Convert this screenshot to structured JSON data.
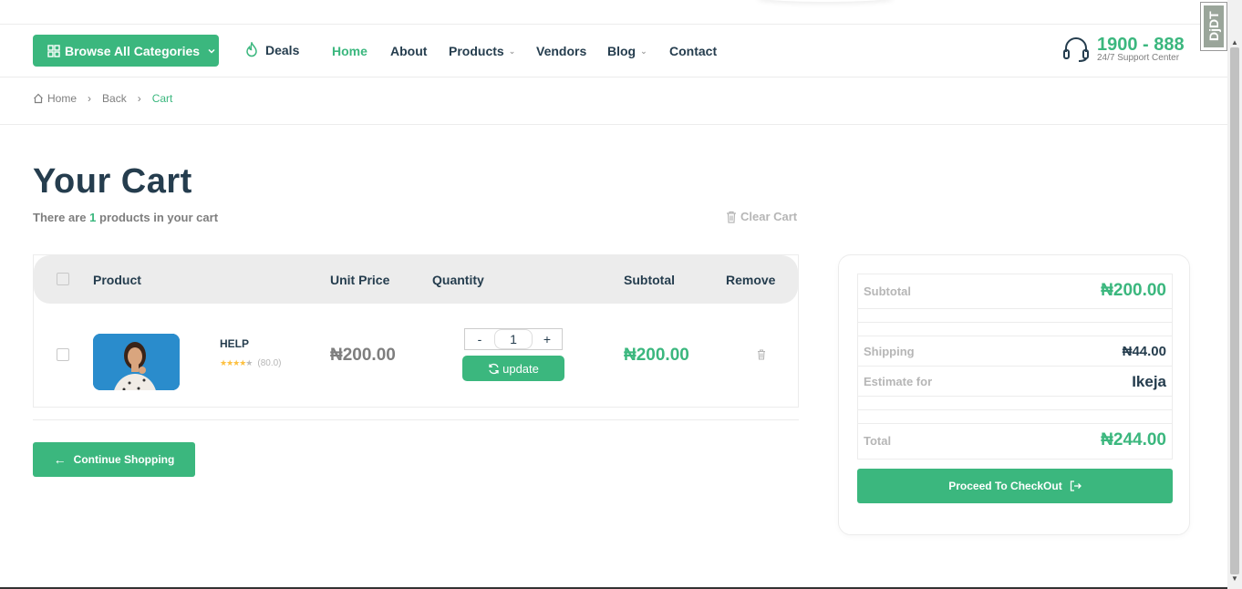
{
  "header": {
    "browse_label": "Browse  All Categories",
    "deals_label": "Deals",
    "nav": [
      {
        "label": "Home",
        "active": true
      },
      {
        "label": "About"
      },
      {
        "label": "Products",
        "has_dropdown": true
      },
      {
        "label": "Vendors"
      },
      {
        "label": "Blog",
        "has_dropdown": true
      },
      {
        "label": "Contact"
      }
    ],
    "phone": "1900 - 888",
    "support_label": "24/7 Support Center",
    "badge_text": "DjDT"
  },
  "breadcrumb": {
    "items": [
      "Home",
      "Back",
      "Cart"
    ],
    "separator": "›"
  },
  "cart": {
    "title": "Your Cart",
    "count_prefix": "There are ",
    "count": "1",
    "count_suffix": " products in your cart",
    "clear_label": "Clear Cart",
    "columns": {
      "product": "Product",
      "unit_price": "Unit Price",
      "quantity": "Quantity",
      "subtotal": "Subtotal",
      "remove": "Remove"
    },
    "items": [
      {
        "name": "HELP",
        "rating": 4,
        "rating_max": 5,
        "rating_count": "(80.0)",
        "unit_price": "₦200.00",
        "quantity": "1",
        "minus_label": "-",
        "plus_label": "+",
        "update_label": "update",
        "subtotal": "₦200.00"
      }
    ],
    "continue_label": "Continue Shopping"
  },
  "summary": {
    "subtotal_label": "Subtotal",
    "subtotal_value": "₦200.00",
    "shipping_label": "Shipping",
    "shipping_value": "₦44.00",
    "estimate_label": "Estimate for",
    "estimate_value": "Ikeja",
    "total_label": "Total",
    "total_value": "₦244.00",
    "checkout_label": "Proceed To CheckOut"
  },
  "colors": {
    "brand": "#3bb77e",
    "heading": "#253d4e",
    "muted": "#7e7e7e",
    "star": "#fdc040"
  }
}
